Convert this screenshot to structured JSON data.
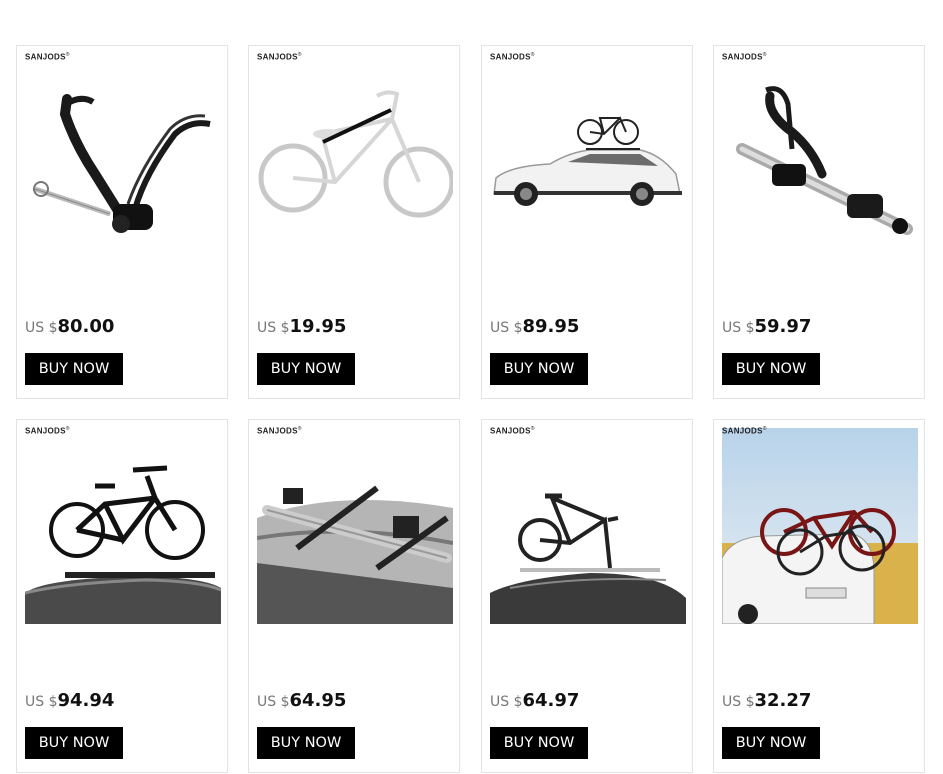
{
  "brand": "SANJODS",
  "products": [
    {
      "brand": "SANJODS",
      "currency": "US $",
      "price": "80.00",
      "button": "BUY NOW",
      "image_icon": "fork-mount-rack-icon"
    },
    {
      "brand": "SANJODS",
      "currency": "US $",
      "price": "19.95",
      "button": "BUY NOW",
      "image_icon": "bike-top-tube-adapter-icon"
    },
    {
      "brand": "SANJODS",
      "currency": "US $",
      "price": "89.95",
      "button": "BUY NOW",
      "image_icon": "car-roof-bike-icon"
    },
    {
      "brand": "SANJODS",
      "currency": "US $",
      "price": "59.97",
      "button": "BUY NOW",
      "image_icon": "upright-roof-rack-icon"
    },
    {
      "brand": "SANJODS",
      "currency": "US $",
      "price": "94.94",
      "button": "BUY NOW",
      "image_icon": "mountain-bike-roof-icon"
    },
    {
      "brand": "SANJODS",
      "currency": "US $",
      "price": "64.95",
      "button": "BUY NOW",
      "image_icon": "roof-rack-closeup-icon"
    },
    {
      "brand": "SANJODS",
      "currency": "US $",
      "price": "64.97",
      "button": "BUY NOW",
      "image_icon": "road-bike-roof-icon"
    },
    {
      "brand": "SANJODS",
      "currency": "US $",
      "price": "32.27",
      "button": "BUY NOW",
      "image_icon": "trunk-rack-bikes-icon"
    }
  ],
  "colors": {
    "button_bg": "#000000",
    "button_text": "#ffffff",
    "border": "#e3e3e3",
    "currency": "#777777"
  }
}
